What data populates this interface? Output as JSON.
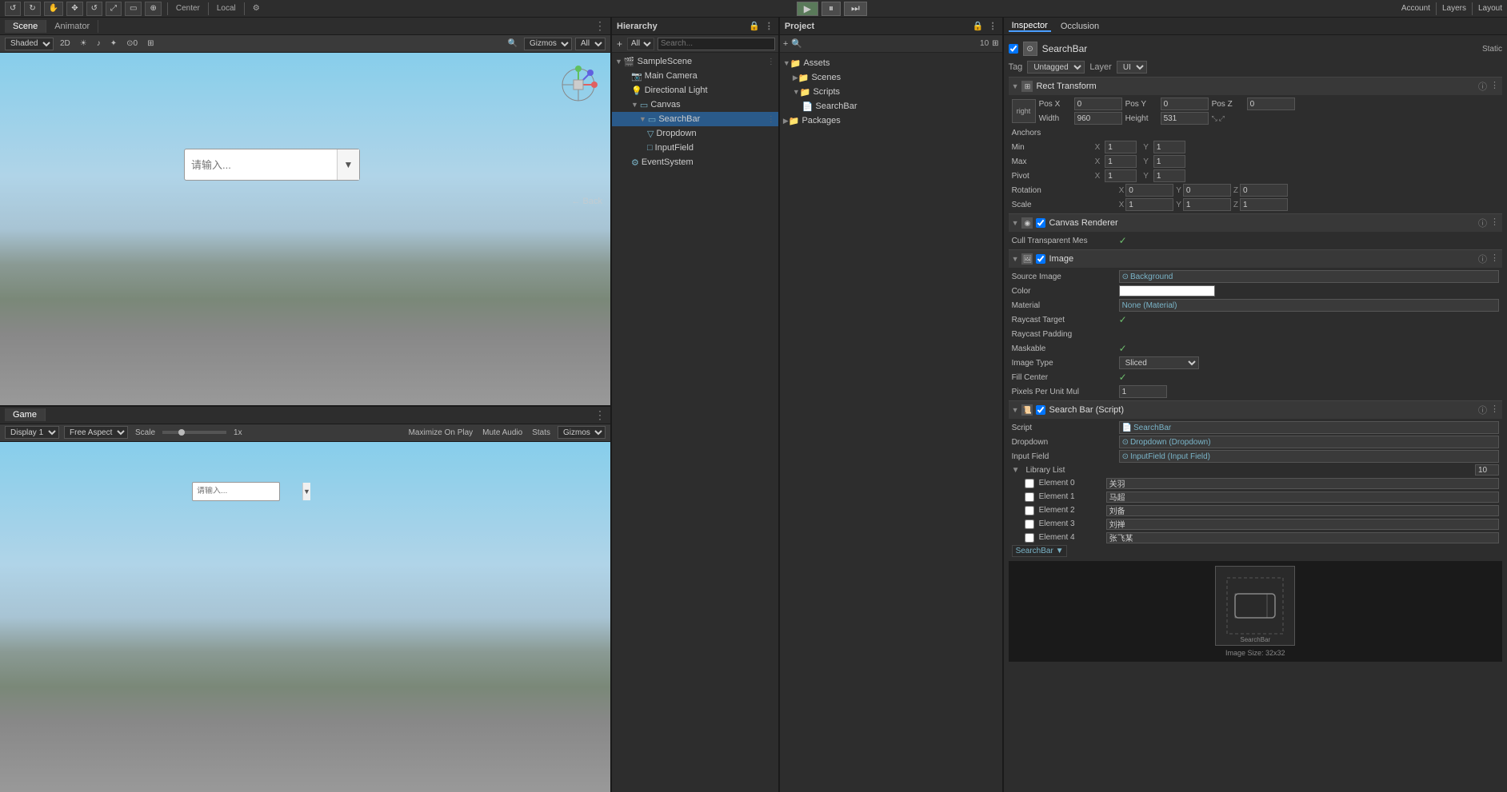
{
  "topbar": {
    "account_label": "Account",
    "layers_label": "Layers",
    "layout_label": "Layout",
    "toolbar_buttons": [
      "undo",
      "redo",
      "move",
      "rotate",
      "scale",
      "rect",
      "transform"
    ],
    "center_label": "Center",
    "local_label": "Local",
    "play_btn": "▶",
    "pause_btn": "⏸",
    "step_btn": "⏭",
    "gizmos_label": "Gizmos",
    "all_label": "All"
  },
  "scene_panel": {
    "tab_scene": "Scene",
    "tab_animator": "Animator",
    "shading_mode": "Shaded",
    "mode_2d": "2D",
    "gizmos_dropdown": "Gizmos",
    "all_dropdown": "All",
    "search_placeholder": "请输入...",
    "search_arrow": "▼",
    "back_label": "← Back"
  },
  "game_panel": {
    "tab_game": "Game",
    "display_label": "Display 1",
    "aspect_label": "Free Aspect",
    "scale_label": "Scale",
    "scale_value": "1x",
    "maximize_label": "Maximize On Play",
    "mute_label": "Mute Audio",
    "stats_label": "Stats",
    "gizmos_label": "Gizmos",
    "search_placeholder": "请输入...",
    "search_arrow": "▼"
  },
  "hierarchy": {
    "title": "Hierarchy",
    "all_dropdown": "All",
    "scene_name": "SampleScene",
    "items": [
      {
        "label": "Main Camera",
        "indent": 2,
        "has_arrow": false,
        "selected": false
      },
      {
        "label": "Directional Light",
        "indent": 2,
        "has_arrow": false,
        "selected": false
      },
      {
        "label": "Canvas",
        "indent": 2,
        "has_arrow": true,
        "selected": false
      },
      {
        "label": "SearchBar",
        "indent": 3,
        "has_arrow": true,
        "selected": true
      },
      {
        "label": "Dropdown",
        "indent": 4,
        "has_arrow": false,
        "selected": false
      },
      {
        "label": "InputField",
        "indent": 4,
        "has_arrow": false,
        "selected": false
      },
      {
        "label": "EventSystem",
        "indent": 2,
        "has_arrow": false,
        "selected": false
      }
    ]
  },
  "project": {
    "title": "Project",
    "search_placeholder": "",
    "folders": [
      {
        "label": "Assets",
        "indent": 0,
        "type": "folder",
        "expanded": true
      },
      {
        "label": "Scenes",
        "indent": 1,
        "type": "folder",
        "expanded": false
      },
      {
        "label": "Scripts",
        "indent": 1,
        "type": "folder",
        "expanded": true
      },
      {
        "label": "SearchBar",
        "indent": 2,
        "type": "script"
      },
      {
        "label": "Packages",
        "indent": 0,
        "type": "folder",
        "expanded": false
      }
    ],
    "num_label": "10"
  },
  "inspector": {
    "title": "Inspector",
    "occlusion_label": "Occlusion",
    "component_name": "SearchBar",
    "static_label": "Static",
    "tag_label": "Tag",
    "tag_value": "Untagged",
    "layer_label": "Layer",
    "layer_value": "UI",
    "rect_transform": {
      "title": "Rect Transform",
      "anchor_preset_label": "right",
      "pos_x_label": "Pos X",
      "pos_x_value": "0",
      "pos_y_label": "Pos Y",
      "pos_y_value": "0",
      "pos_z_label": "Pos Z",
      "pos_z_value": "0",
      "width_label": "Width",
      "width_value": "960",
      "height_label": "Height",
      "height_value": "531",
      "anchors_label": "Anchors",
      "min_label": "Min",
      "min_x": "1",
      "min_y": "1",
      "max_label": "Max",
      "max_x": "1",
      "max_y": "1",
      "pivot_label": "Pivot",
      "pivot_x": "1",
      "pivot_y": "1",
      "rotation_label": "Rotation",
      "rot_x": "0",
      "rot_y": "0",
      "rot_z": "0",
      "scale_label": "Scale",
      "scale_x": "1",
      "scale_y": "1",
      "scale_z": "1"
    },
    "canvas_renderer": {
      "title": "Canvas Renderer",
      "cull_label": "Cull Transparent Mes",
      "cull_checked": true
    },
    "image": {
      "title": "Image",
      "source_image_label": "Source Image",
      "source_image_value": "Background",
      "color_label": "Color",
      "material_label": "Material",
      "material_value": "None (Material)",
      "raycast_target_label": "Raycast Target",
      "raycast_padding_label": "Raycast Padding",
      "maskable_label": "Maskable",
      "image_type_label": "Image Type",
      "image_type_value": "Sliced",
      "fill_center_label": "Fill Center",
      "pixels_per_unit_label": "Pixels Per Unit Mul",
      "pixels_per_unit_value": "1"
    },
    "search_bar_script": {
      "title": "Search Bar (Script)",
      "script_label": "Script",
      "script_value": "SearchBar",
      "dropdown_label": "Dropdown",
      "dropdown_value": "Dropdown (Dropdown)",
      "input_field_label": "Input Field",
      "input_field_value": "InputField (Input Field)",
      "library_list_label": "Library List",
      "library_list_count": "10",
      "elements": [
        {
          "index": "Element 0",
          "value": "关羽"
        },
        {
          "index": "Element 1",
          "value": "马超"
        },
        {
          "index": "Element 2",
          "value": "刘备"
        },
        {
          "index": "Element 3",
          "value": "刘禅"
        },
        {
          "index": "Element 4",
          "value": "张飞某"
        }
      ]
    },
    "searchbar_label": "SearchBar ▼",
    "preview_label": "SearchBar",
    "image_size_label": "Image Size: 32x32"
  }
}
